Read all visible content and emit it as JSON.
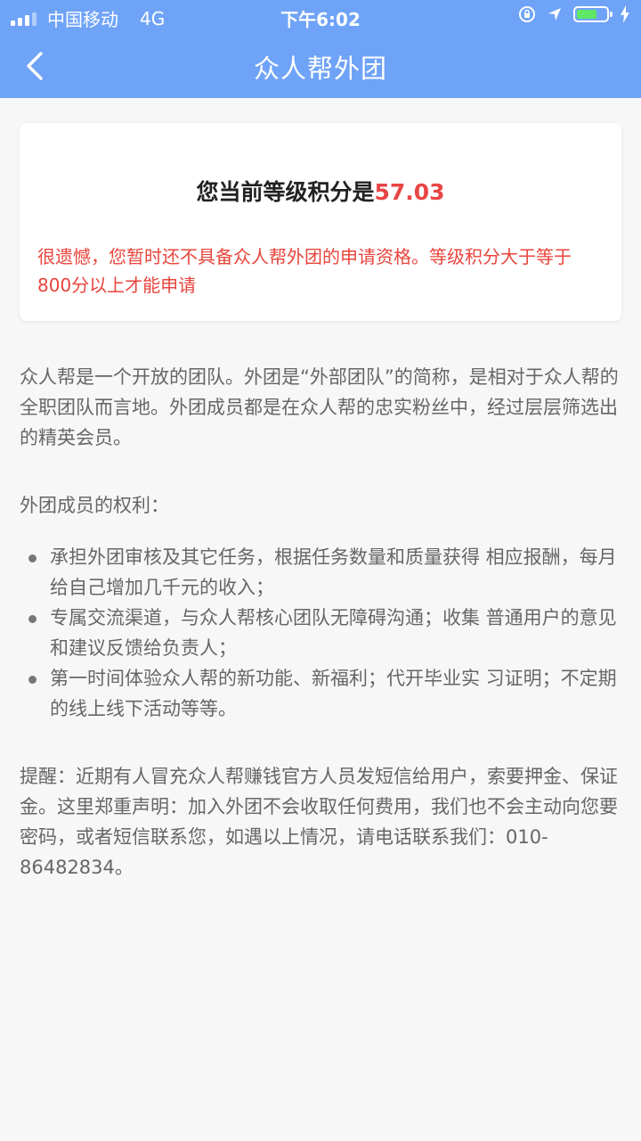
{
  "status_bar": {
    "carrier": "中国移动",
    "network": "4G",
    "time": "下午6:02"
  },
  "nav": {
    "title": "众人帮外团"
  },
  "score_card": {
    "label": "您当前等级积分是",
    "score": "57.03",
    "warning": "很遗憾，您暂时还不具备众人帮外团的申请资格。等级积分大于等于800分以上才能申请"
  },
  "content": {
    "intro": "众人帮是一个开放的团队。外团是“外部团队”的简称，是相对于众人帮的全职团队而言地。外团成员都是在众人帮的忠实粉丝中，经过层层筛选出的精英会员。",
    "rights_title": "外团成员的权利：",
    "benefits": [
      "承担外团审核及其它任务，根据任务数量和质量获得 相应报酬，每月给自己增加几千元的收入；",
      "专属交流渠道，与众人帮核心团队无障碍沟通；收集 普通用户的意见和建议反馈给负责人；",
      "第一时间体验众人帮的新功能、新福利；代开毕业实 习证明；不定期的线上线下活动等等。"
    ],
    "reminder": "提醒：近期有人冒充众人帮赚钱官方人员发短信给用户，索要押金、保证金。这里郑重声明：加入外团不会收取任何费用，我们也不会主动向您要密码，或者短信联系您，如遇以上情况，请电话联系我们：010-86482834。"
  },
  "colors": {
    "header_bg": "#6fa3f7",
    "accent_red": "#e84545",
    "battery_green": "#5ee866"
  },
  "icons": {
    "back": "chevron-left-icon",
    "signal": "signal-icon",
    "lock": "rotation-lock-icon",
    "location": "location-arrow-icon",
    "battery": "battery-icon",
    "charging": "charging-bolt-icon"
  }
}
